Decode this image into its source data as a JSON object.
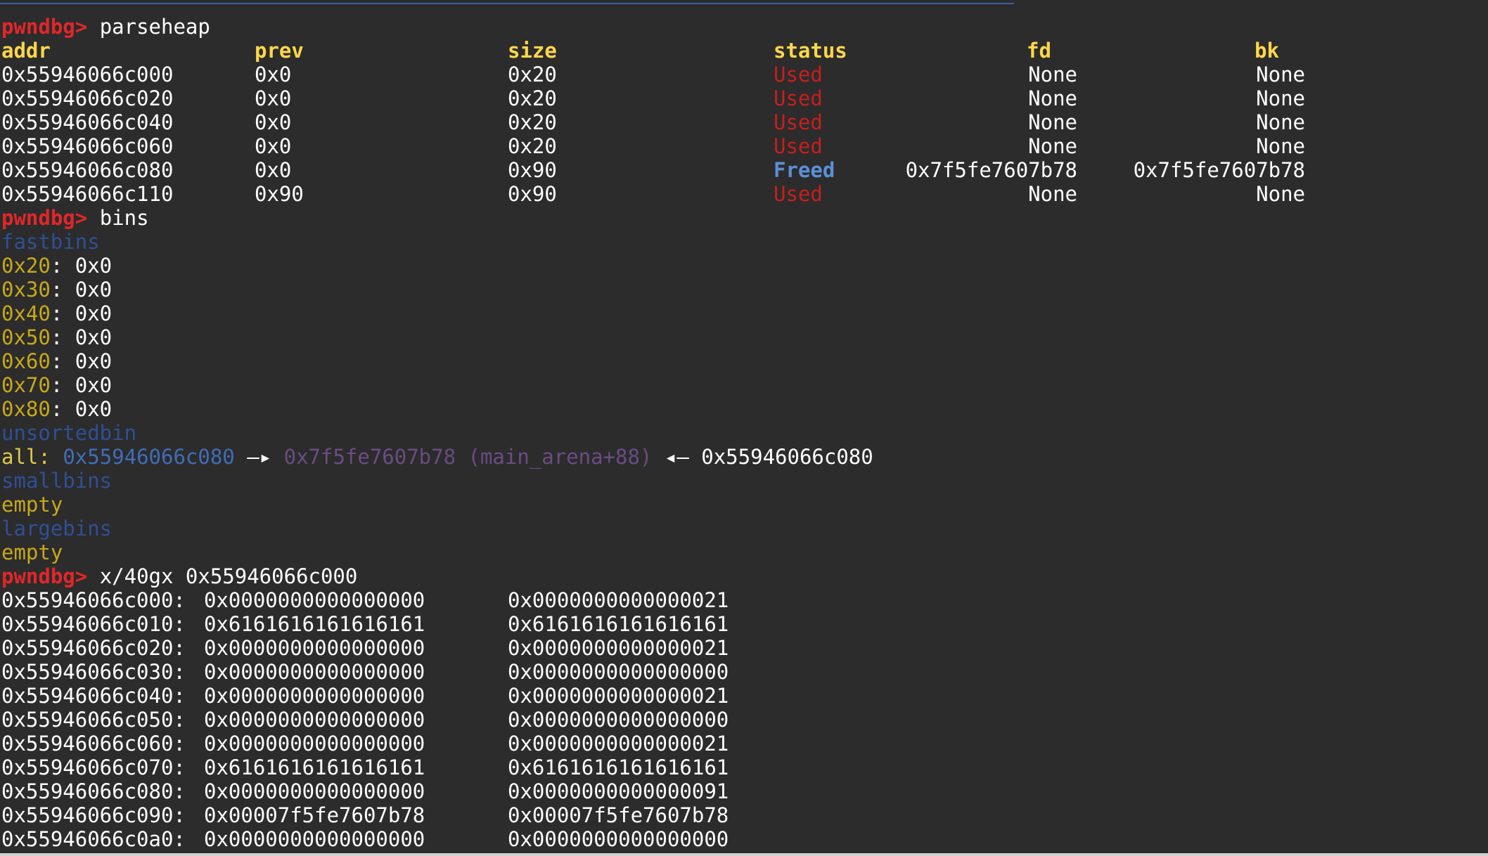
{
  "prompt": "pwndbg>",
  "cmd_parseheap": "parseheap",
  "cmd_bins": "bins",
  "cmd_x": "x/40gx 0x55946066c000",
  "heap_headers": {
    "addr": "addr",
    "prev": "prev",
    "size": "size",
    "status": "status",
    "fd": "fd",
    "bk": "bk"
  },
  "heap_rows": [
    {
      "addr": "0x55946066c000",
      "prev": "0x0",
      "size": "0x20",
      "status": "Used",
      "fd": "None",
      "bk": "None"
    },
    {
      "addr": "0x55946066c020",
      "prev": "0x0",
      "size": "0x20",
      "status": "Used",
      "fd": "None",
      "bk": "None"
    },
    {
      "addr": "0x55946066c040",
      "prev": "0x0",
      "size": "0x20",
      "status": "Used",
      "fd": "None",
      "bk": "None"
    },
    {
      "addr": "0x55946066c060",
      "prev": "0x0",
      "size": "0x20",
      "status": "Used",
      "fd": "None",
      "bk": "None"
    },
    {
      "addr": "0x55946066c080",
      "prev": "0x0",
      "size": "0x90",
      "status": "Freed",
      "fd": "0x7f5fe7607b78",
      "bk": "0x7f5fe7607b78"
    },
    {
      "addr": "0x55946066c110",
      "prev": "0x90",
      "size": "0x90",
      "status": "Used",
      "fd": "None",
      "bk": "None"
    }
  ],
  "fastbins_label": "fastbins",
  "fastbins": [
    {
      "size": "0x20",
      "value": "0x0"
    },
    {
      "size": "0x30",
      "value": "0x0"
    },
    {
      "size": "0x40",
      "value": "0x0"
    },
    {
      "size": "0x50",
      "value": "0x0"
    },
    {
      "size": "0x60",
      "value": "0x0"
    },
    {
      "size": "0x70",
      "value": "0x0"
    },
    {
      "size": "0x80",
      "value": "0x0"
    }
  ],
  "unsorted": {
    "label": "unsortedbin",
    "all_label": "all:",
    "chunk": "0x55946066c080",
    "arrow_right": "—▸",
    "target": "0x7f5fe7607b78 (main_arena+88)",
    "arrow_left": "◂—",
    "back": "0x55946066c080"
  },
  "smallbins_label": "smallbins",
  "smallbins_value": "empty",
  "largebins_label": "largebins",
  "largebins_value": "empty",
  "memory_rows": [
    {
      "addr": "0x55946066c000:",
      "v1": "0x0000000000000000",
      "v2": "0x0000000000000021"
    },
    {
      "addr": "0x55946066c010:",
      "v1": "0x6161616161616161",
      "v2": "0x6161616161616161"
    },
    {
      "addr": "0x55946066c020:",
      "v1": "0x0000000000000000",
      "v2": "0x0000000000000021"
    },
    {
      "addr": "0x55946066c030:",
      "v1": "0x0000000000000000",
      "v2": "0x0000000000000000"
    },
    {
      "addr": "0x55946066c040:",
      "v1": "0x0000000000000000",
      "v2": "0x0000000000000021"
    },
    {
      "addr": "0x55946066c050:",
      "v1": "0x0000000000000000",
      "v2": "0x0000000000000000"
    },
    {
      "addr": "0x55946066c060:",
      "v1": "0x0000000000000000",
      "v2": "0x0000000000000021"
    },
    {
      "addr": "0x55946066c070:",
      "v1": "0x6161616161616161",
      "v2": "0x6161616161616161"
    },
    {
      "addr": "0x55946066c080:",
      "v1": "0x0000000000000000",
      "v2": "0x0000000000000091"
    },
    {
      "addr": "0x55946066c090:",
      "v1": "0x00007f5fe7607b78",
      "v2": "0x00007f5fe7607b78"
    },
    {
      "addr": "0x55946066c0a0:",
      "v1": "0x0000000000000000",
      "v2": "0x0000000000000000"
    }
  ],
  "colors": {
    "background": "#2c2c2c",
    "prompt": "#e2262a",
    "header": "#ffd74a",
    "used": "#c81e1e",
    "freed": "#5b8fd9",
    "bin_label": "#2f4f97",
    "bin_size": "#c8a81a"
  }
}
